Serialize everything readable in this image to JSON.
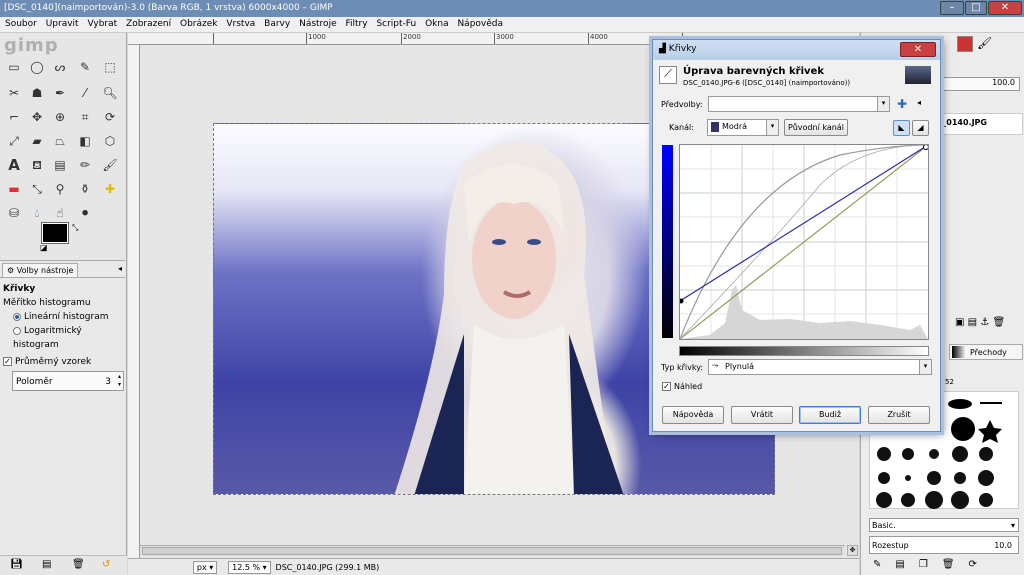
{
  "window": {
    "title": "[DSC_0140](naimportován)-3.0 (Barva RGB, 1 vrstva) 6000x4000 – GIMP",
    "min": "–",
    "max": "□",
    "close": "✕"
  },
  "menubar": [
    "Soubor",
    "Upravit",
    "Vybrat",
    "Zobrazení",
    "Obrázek",
    "Vrstva",
    "Barvy",
    "Nástroje",
    "Filtry",
    "Script-Fu",
    "Okna",
    "Nápověda"
  ],
  "toolbox": {
    "logo": "gimp",
    "tool_options": {
      "tab_label": "Volby nástroje",
      "tool_name": "Křivky",
      "section": "Měřítko histogramu",
      "linear": "Lineární histogram",
      "log": "Logaritmický histogram",
      "avg_label": "Průměrný vzorek",
      "radius_label": "Poloměr",
      "radius_value": "3"
    }
  },
  "canvas": {
    "ruler_labels": [
      "1000",
      "2000",
      "3000",
      "4000"
    ],
    "zoom_unit": "px",
    "zoom": "12.5 %",
    "status": "DSC_0140.JPG (299.1 MB)"
  },
  "dialog": {
    "title": "Křivky",
    "header": "Úprava barevných křivek",
    "subheader": "DSC_0140.JPG-6 ([DSC_0140] (naimportováno))",
    "presets_label": "Předvolby:",
    "presets_value": "",
    "channel_label": "Kanál:",
    "channel_value": "Modrá",
    "reset_channel": "Původní kanál",
    "curve_type_label": "Typ křivky:",
    "curve_type_value": "Plynulá",
    "preview_label": "Náhled",
    "buttons": {
      "help": "Nápověda",
      "reset": "Vrátit",
      "ok": "Budiž",
      "cancel": "Zrušit"
    }
  },
  "right_dock": {
    "opacity_value": "100.0",
    "layer_name": "DSC_0140.JPG",
    "gradients_tab": "Přechody",
    "brush_count": "52",
    "brush_preset": "Basic.",
    "spacing_label": "Rozestup",
    "spacing_value": "10.0"
  }
}
